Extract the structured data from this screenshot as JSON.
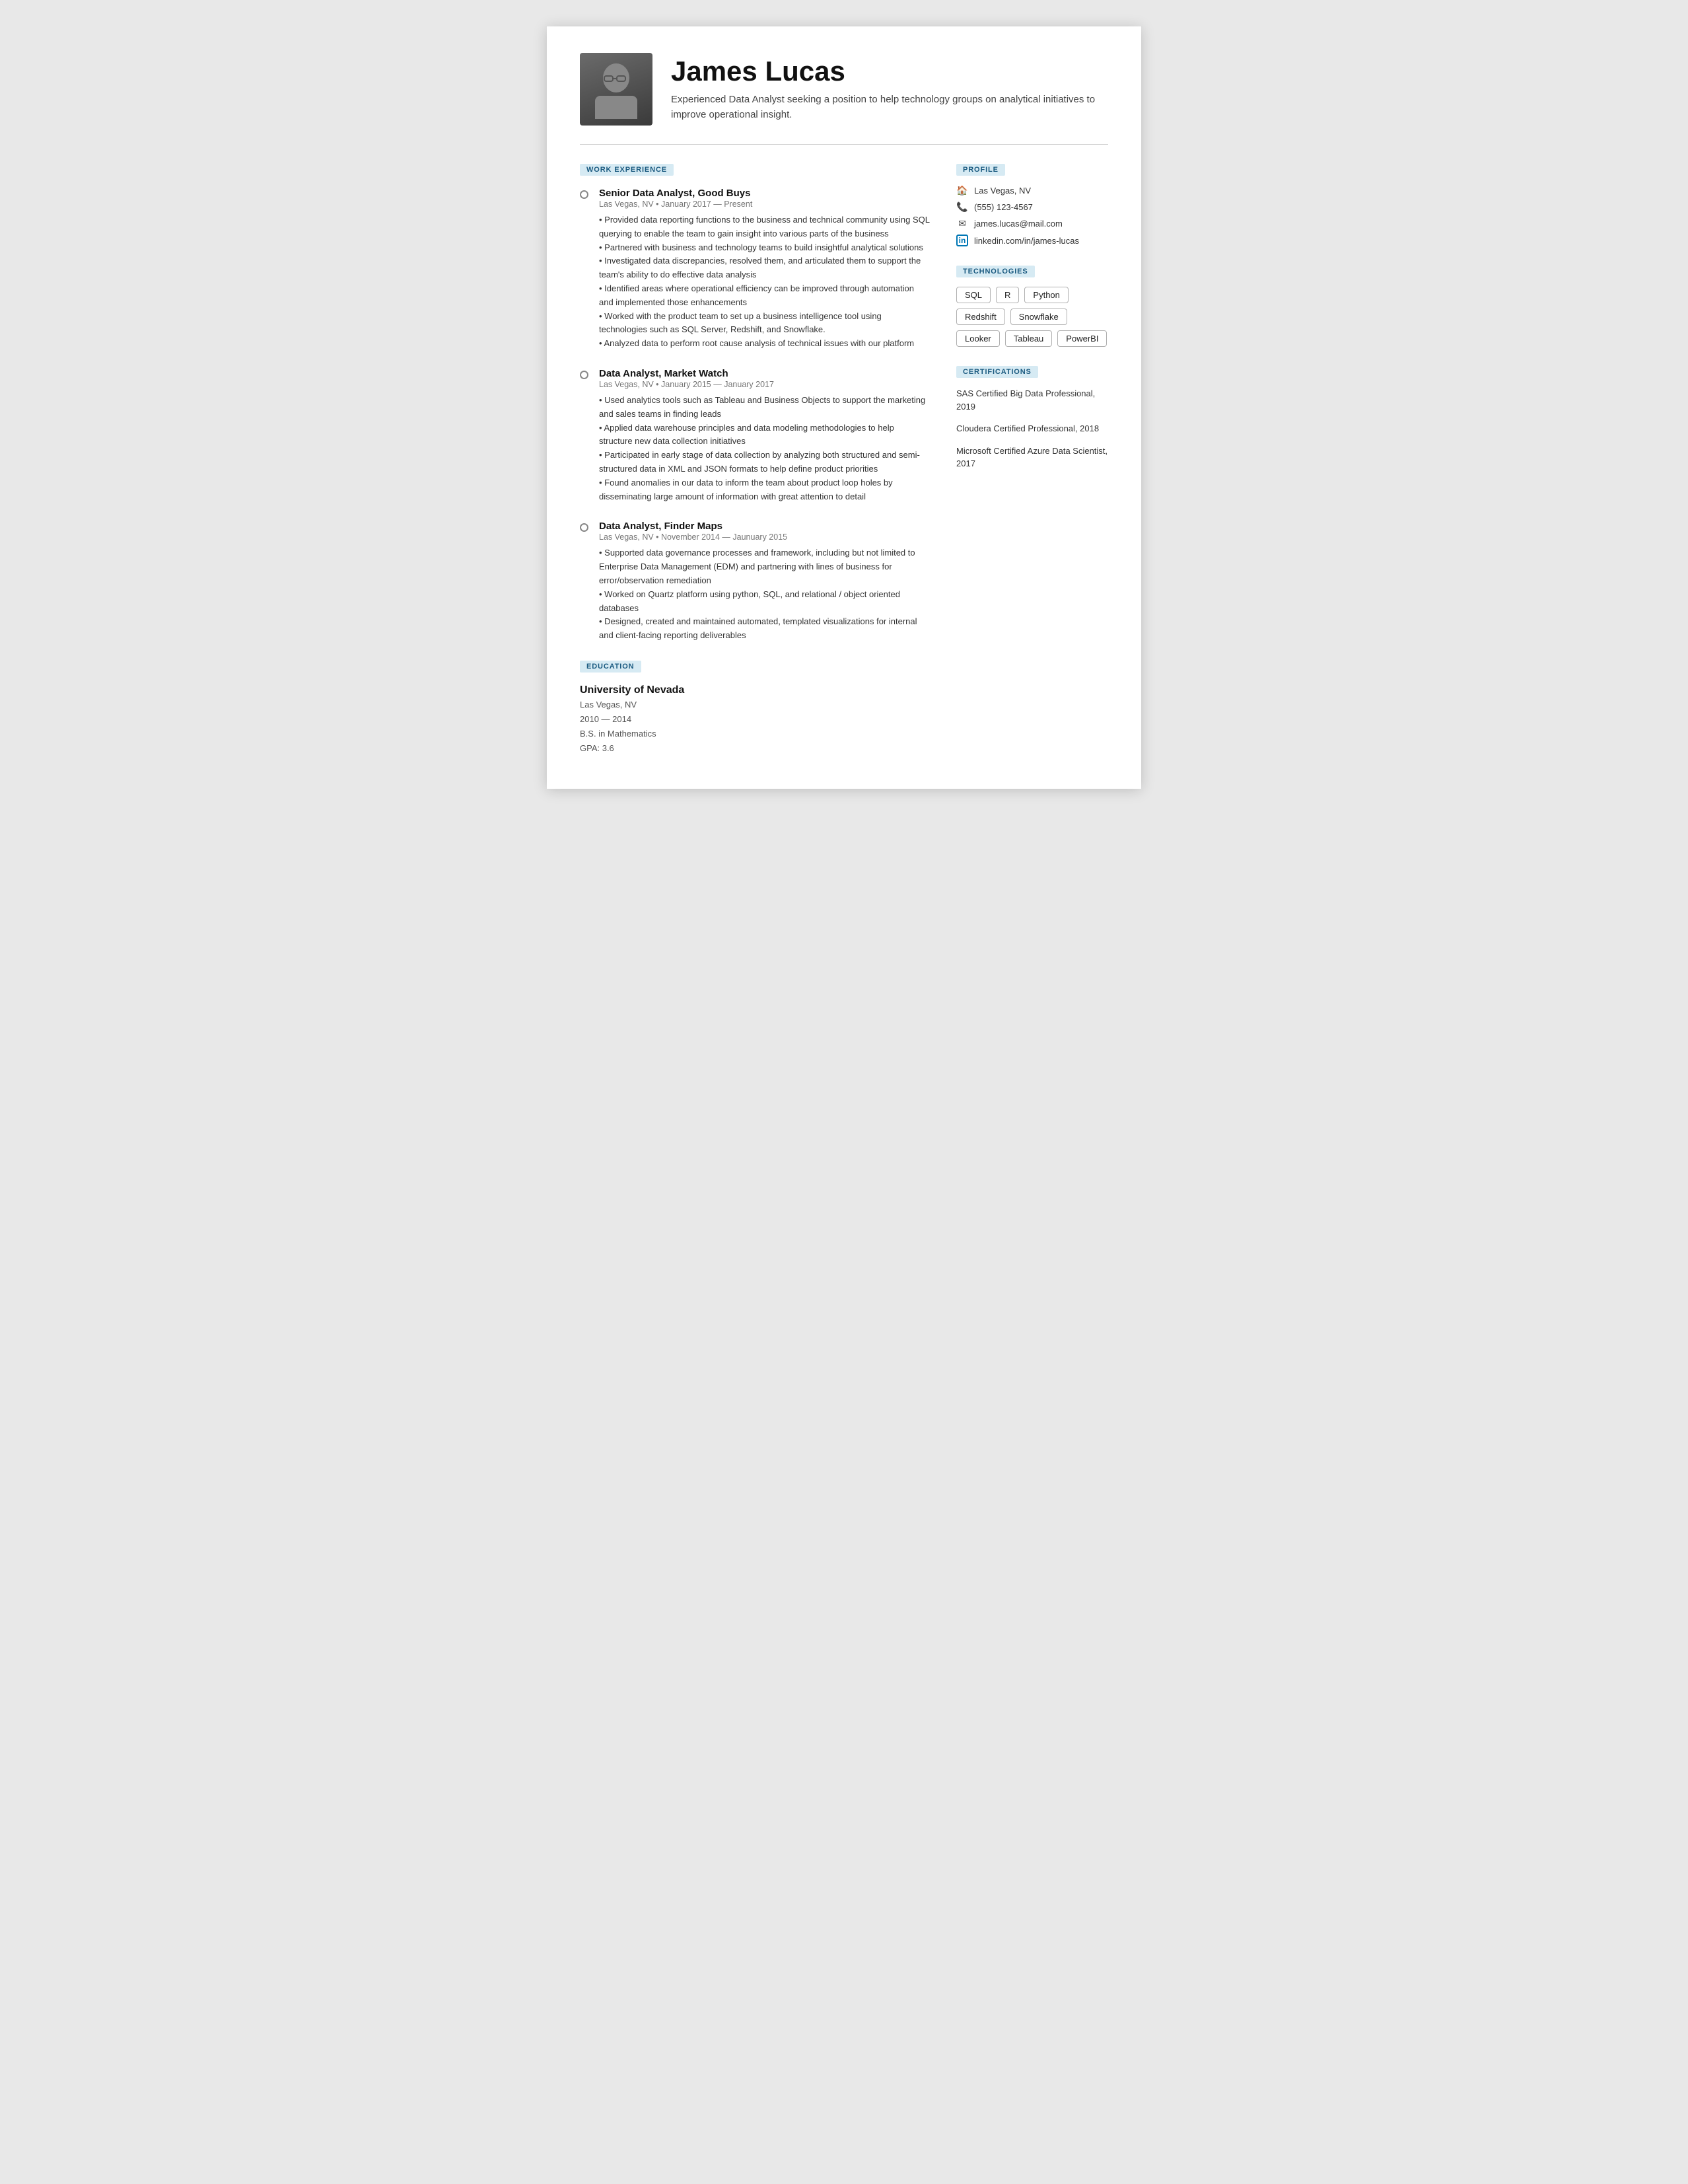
{
  "header": {
    "name": "James Lucas",
    "tagline": "Experienced Data Analyst seeking a position to help technology groups on analytical initiatives to improve operational insight."
  },
  "sections": {
    "work_experience_label": "WORK EXPERIENCE",
    "education_label": "EDUCATION",
    "profile_label": "PROFILE",
    "technologies_label": "TECHNOLOGIES",
    "certifications_label": "CERTIFICATIONS"
  },
  "jobs": [
    {
      "title": "Senior Data Analyst, Good Buys",
      "meta": "Las Vegas, NV • January 2017 — Present",
      "bullets": "• Provided data reporting functions to the business and technical community using SQL querying to enable the team to gain insight into various parts of the business\n• Partnered with business and technology teams to build insightful analytical solutions\n• Investigated data discrepancies, resolved them, and articulated them to support the team's ability to do effective data analysis\n• Identified areas where operational efficiency can be improved through automation and implemented those enhancements\n• Worked with the product team to set up a business intelligence tool using technologies such as SQL Server, Redshift, and Snowflake.\n• Analyzed data to perform root cause analysis of technical issues with our platform"
    },
    {
      "title": "Data Analyst, Market Watch",
      "meta": "Las Vegas, NV • January 2015 — January 2017",
      "bullets": "• Used analytics tools such as Tableau and Business Objects to support the marketing and sales teams in finding leads\n• Applied data warehouse principles and data modeling methodologies to help structure new data collection initiatives\n• Participated in early stage of data collection by analyzing both structured and semi-structured data in XML and JSON formats to help define product priorities\n• Found anomalies in our data to inform the team about product loop holes by disseminating large amount of information with great attention to detail"
    },
    {
      "title": "Data Analyst, Finder Maps",
      "meta": "Las Vegas, NV • November 2014 — Jaunuary 2015",
      "bullets": "• Supported data governance processes and framework, including but not limited to Enterprise Data Management (EDM) and partnering with lines of business for error/observation remediation\n• Worked on Quartz platform using python, SQL, and relational / object oriented databases\n• Designed, created and maintained automated, templated visualizations for internal and client-facing reporting deliverables"
    }
  ],
  "education": {
    "school": "University of Nevada",
    "city": "Las Vegas, NV",
    "years": "2010 — 2014",
    "degree": "B.S. in Mathematics",
    "gpa": "GPA: 3.6"
  },
  "profile": {
    "location": "Las Vegas, NV",
    "phone": "(555) 123-4567",
    "email": "james.lucas@mail.com",
    "linkedin": "linkedin.com/in/james-lucas"
  },
  "technologies": [
    "SQL",
    "R",
    "Python",
    "Redshift",
    "Snowflake",
    "Looker",
    "Tableau",
    "PowerBI"
  ],
  "certifications": [
    "SAS Certified Big Data Professional, 2019",
    "Cloudera Certified Professional, 2018",
    "Microsoft Certified Azure Data Scientist, 2017"
  ]
}
